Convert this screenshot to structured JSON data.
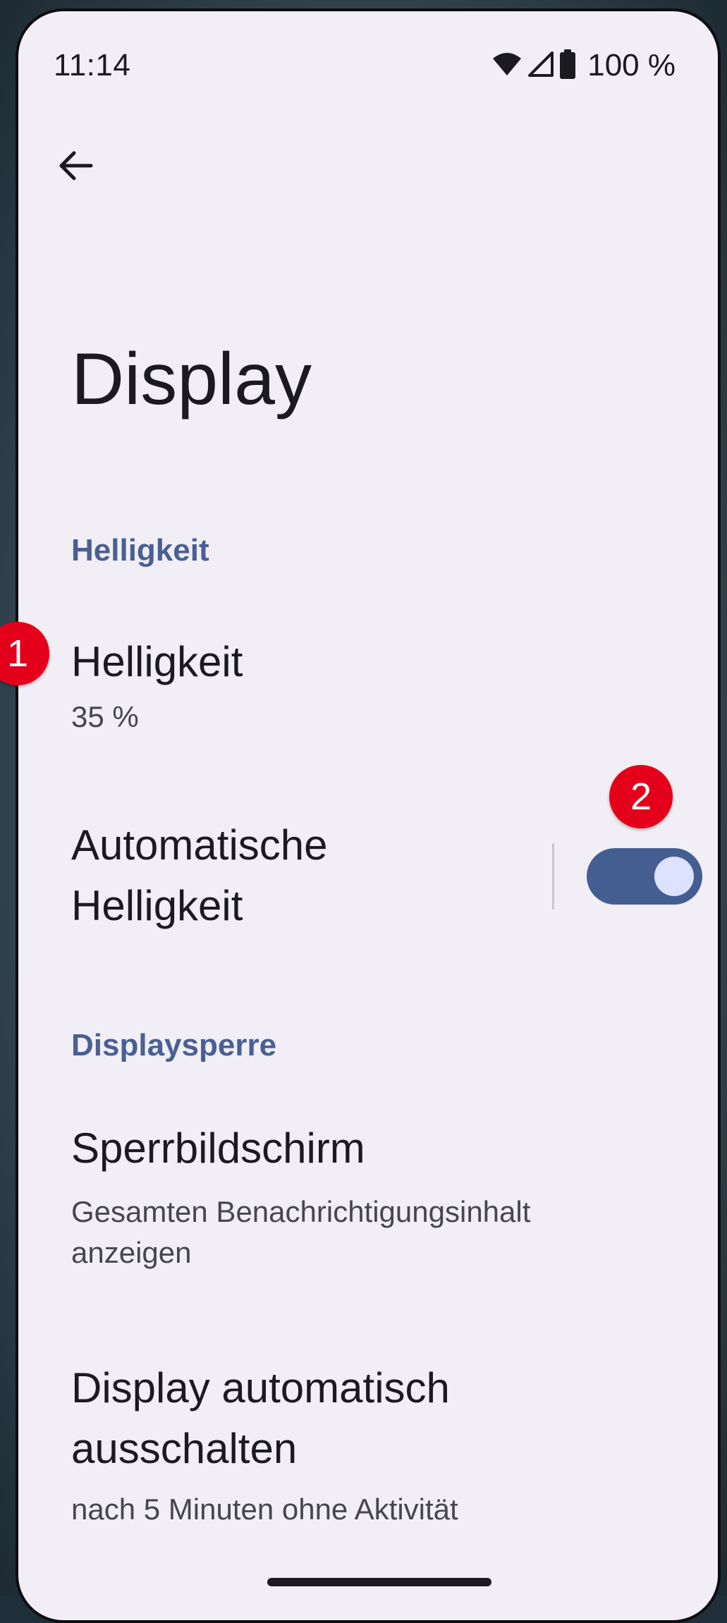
{
  "status_bar": {
    "time": "11:14",
    "battery_text": "100 %"
  },
  "page": {
    "title": "Display"
  },
  "sections": {
    "brightness_header": "Helligkeit",
    "display_lock_header": "Displaysperre"
  },
  "items": {
    "brightness": {
      "title": "Helligkeit",
      "summary": "35 %",
      "level_percent": 35
    },
    "auto_brightness": {
      "title_line1": "Automatische",
      "title_line2": "Helligkeit",
      "enabled": true
    },
    "lock_screen": {
      "title": "Sperrbildschirm",
      "summary_line1": "Gesamten Benachrichtigungsinhalt",
      "summary_line2": "anzeigen"
    },
    "screen_timeout": {
      "title_line1": "Display automatisch",
      "title_line2": "ausschalten",
      "summary": "nach 5 Minuten ohne Aktivität"
    }
  },
  "markers": {
    "first": "1",
    "second": "2"
  },
  "colors": {
    "background": "#f1eff5",
    "accent": "#445e92",
    "section_header": "#4a5f93",
    "marker": "#e4001b"
  },
  "icons": {
    "back": "arrow-left-icon",
    "wifi": "wifi-icon",
    "signal": "cell-signal-icon",
    "battery": "battery-icon"
  }
}
